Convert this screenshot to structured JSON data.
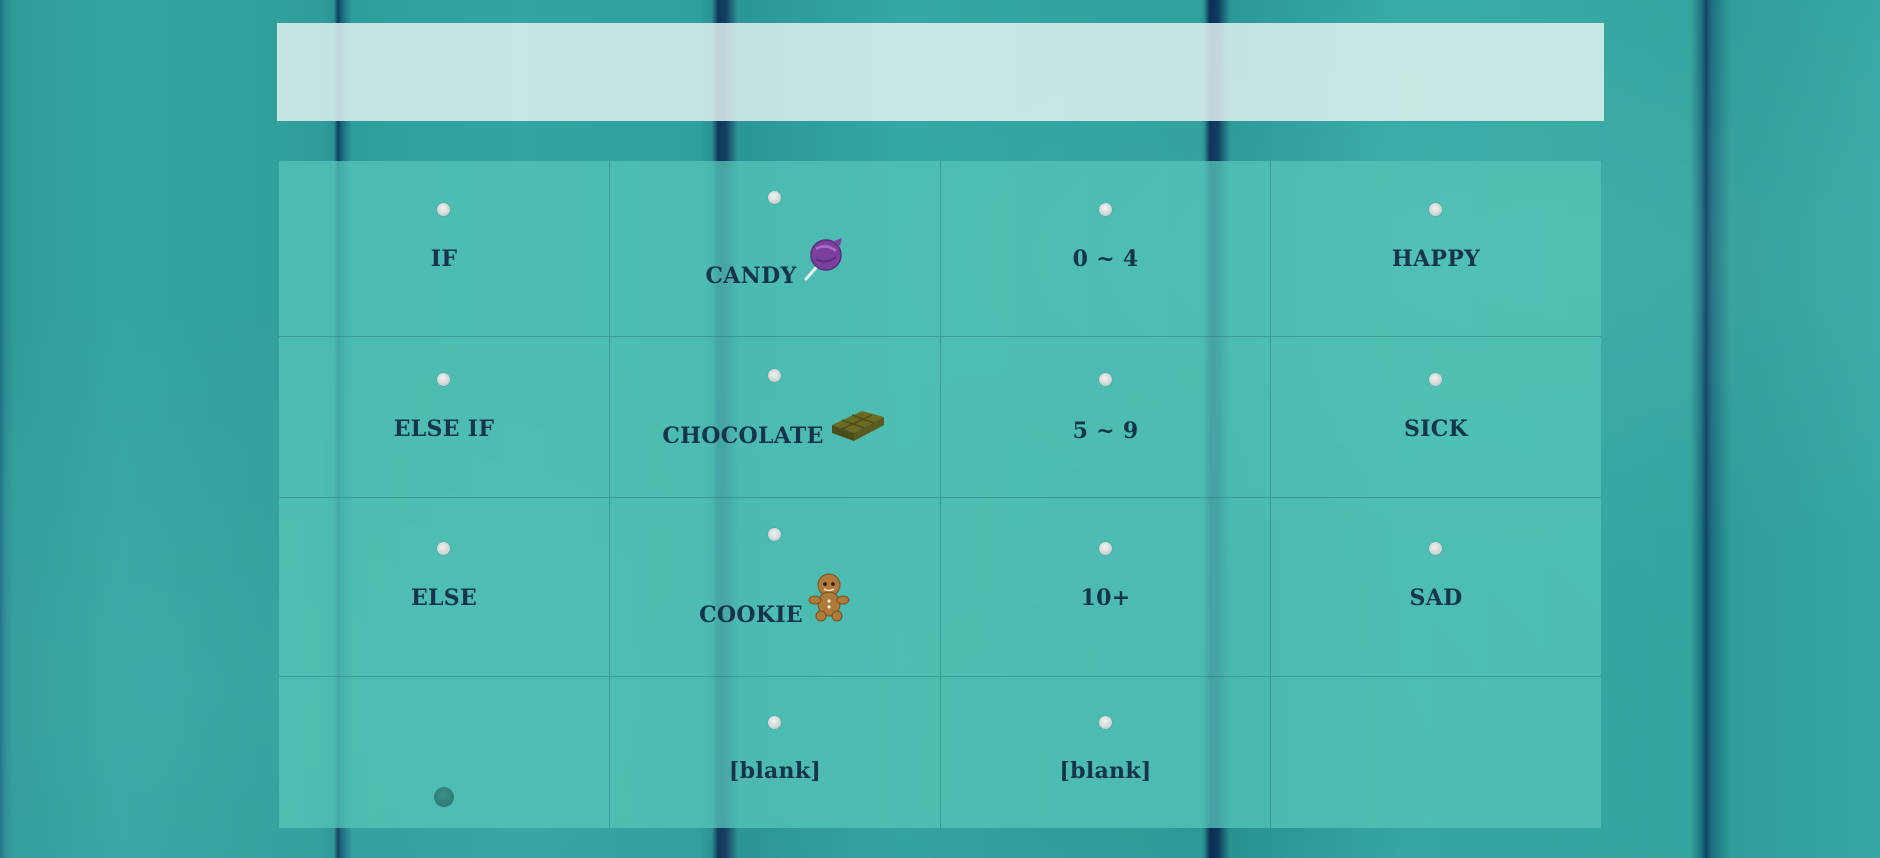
{
  "grid": {
    "rows": [
      [
        {
          "label": "IF"
        },
        {
          "label": "CANDY",
          "icon": "lollipop-icon"
        },
        {
          "label": "0 ~ 4"
        },
        {
          "label": "HAPPY"
        }
      ],
      [
        {
          "label": "ELSE IF"
        },
        {
          "label": "CHOCOLATE",
          "icon": "chocolate-bar-icon"
        },
        {
          "label": "5 ~ 9"
        },
        {
          "label": "SICK"
        }
      ],
      [
        {
          "label": "ELSE"
        },
        {
          "label": "COOKIE",
          "icon": "gingerbread-cookie-icon"
        },
        {
          "label": "10+"
        },
        {
          "label": "SAD"
        }
      ],
      [
        {
          "label": ""
        },
        {
          "label": "[blank]"
        },
        {
          "label": "[blank]"
        },
        {
          "label": ""
        }
      ]
    ]
  },
  "colors": {
    "text": "#16354a",
    "lollipop": "#7b3f9e",
    "chocolate": "#5a5a1e",
    "cookie": "#b07a3a"
  }
}
